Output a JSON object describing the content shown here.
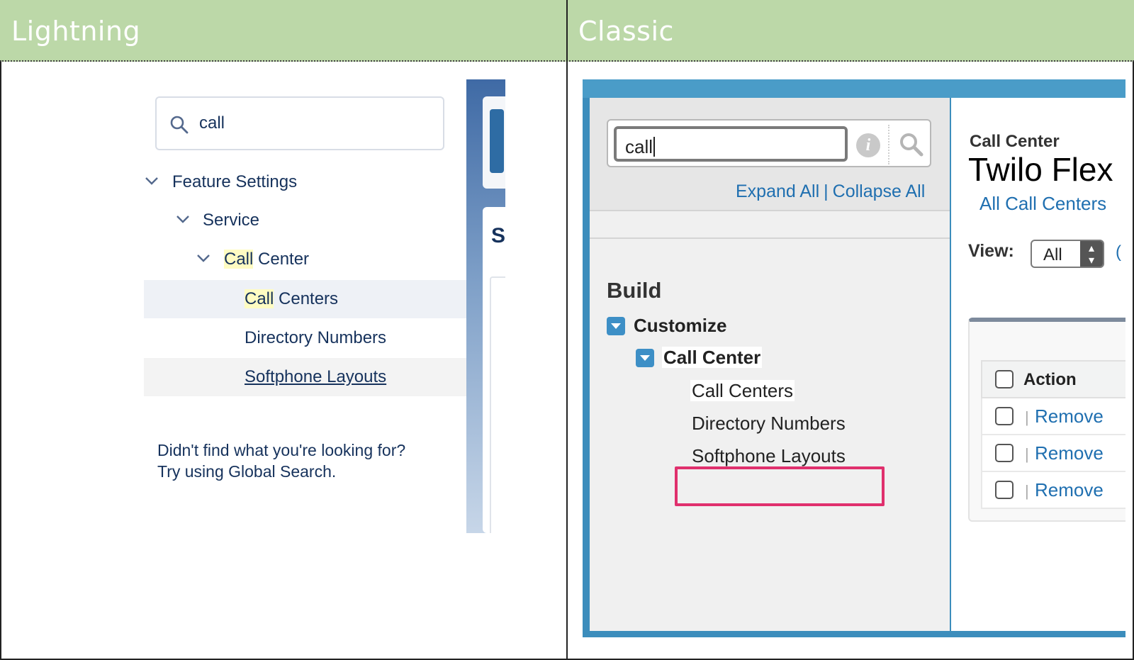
{
  "headers": {
    "left": "Lightning",
    "right": "Classic"
  },
  "lightning": {
    "search_value": "call",
    "tree": [
      {
        "label": "Feature Settings",
        "highlight": "",
        "rest": "Feature Settings"
      },
      {
        "label": "Service",
        "highlight": "",
        "rest": "Service"
      },
      {
        "highlight": "Call",
        "rest": " Center"
      },
      {
        "highlight": "Call",
        "rest": " Centers"
      },
      {
        "label": "Directory Numbers"
      },
      {
        "label": "Softphone Layouts"
      }
    ],
    "footer_line1": "Didn't find what you're looking for?",
    "footer_line2": "Try using Global Search."
  },
  "classic": {
    "search_value": "call",
    "info_glyph": "i",
    "expand_all": "Expand All",
    "pipe": "|",
    "collapse_all": "Collapse All",
    "build": "Build",
    "tree": {
      "customize": "Customize",
      "call_center": "Call Center",
      "call_centers": "Call Centers",
      "directory_numbers": "Directory Numbers",
      "softphone_layouts": "Softphone Layouts"
    },
    "main": {
      "crumb": "Call Center",
      "title": "Twilo Flex",
      "all_link": "All Call Centers",
      "view_label": "View:",
      "view_value": "All",
      "partial_link": "(",
      "table_header": "Action",
      "row_sep": "|",
      "rows": [
        "Remove",
        "Remove",
        "Remove"
      ]
    }
  },
  "colors": {
    "header_bg": "#bcd8a8",
    "lightning_text": "#16325c",
    "classic_frame": "#3c8dbc",
    "link": "#1f6fb0",
    "highlight_box": "#e0306d",
    "search_highlight": "#fffcc2"
  },
  "icons": {
    "lightning_search": "search-icon",
    "chevron": "chevron-down-icon",
    "classic_info": "info-icon",
    "classic_search": "search-icon",
    "twisty": "expand-twisty-icon"
  }
}
